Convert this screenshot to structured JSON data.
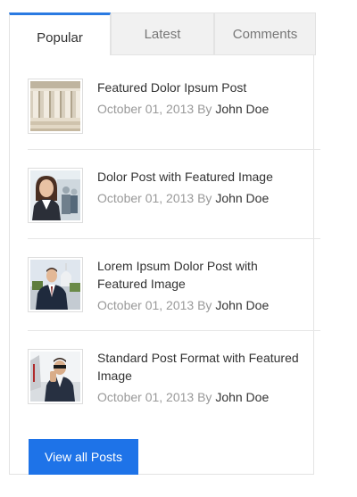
{
  "tabs": [
    {
      "label": "Popular",
      "active": true
    },
    {
      "label": "Latest",
      "active": false
    },
    {
      "label": "Comments",
      "active": false
    }
  ],
  "posts": [
    {
      "title": "Featured Dolor Ipsum Post",
      "date": "October 01, 2013",
      "by": "By",
      "author": "John Doe",
      "image": "columns-photo"
    },
    {
      "title": "Dolor Post with Featured Image",
      "date": "October 01, 2013",
      "by": "By",
      "author": "John Doe",
      "image": "businesswoman-photo"
    },
    {
      "title": "Lorem Ipsum Dolor Post with Featured Image",
      "date": "October 01, 2013",
      "by": "By",
      "author": "John Doe",
      "image": "businessman-capitol-photo"
    },
    {
      "title": "Standard Post Format with Featured Image",
      "date": "October 01, 2013",
      "by": "By",
      "author": "John Doe",
      "image": "man-phone-photo"
    }
  ],
  "view_all_label": "View all Posts",
  "colors": {
    "accent": "#1e73e8",
    "active_tab_border": "#2a7ae2",
    "meta": "#999999"
  }
}
